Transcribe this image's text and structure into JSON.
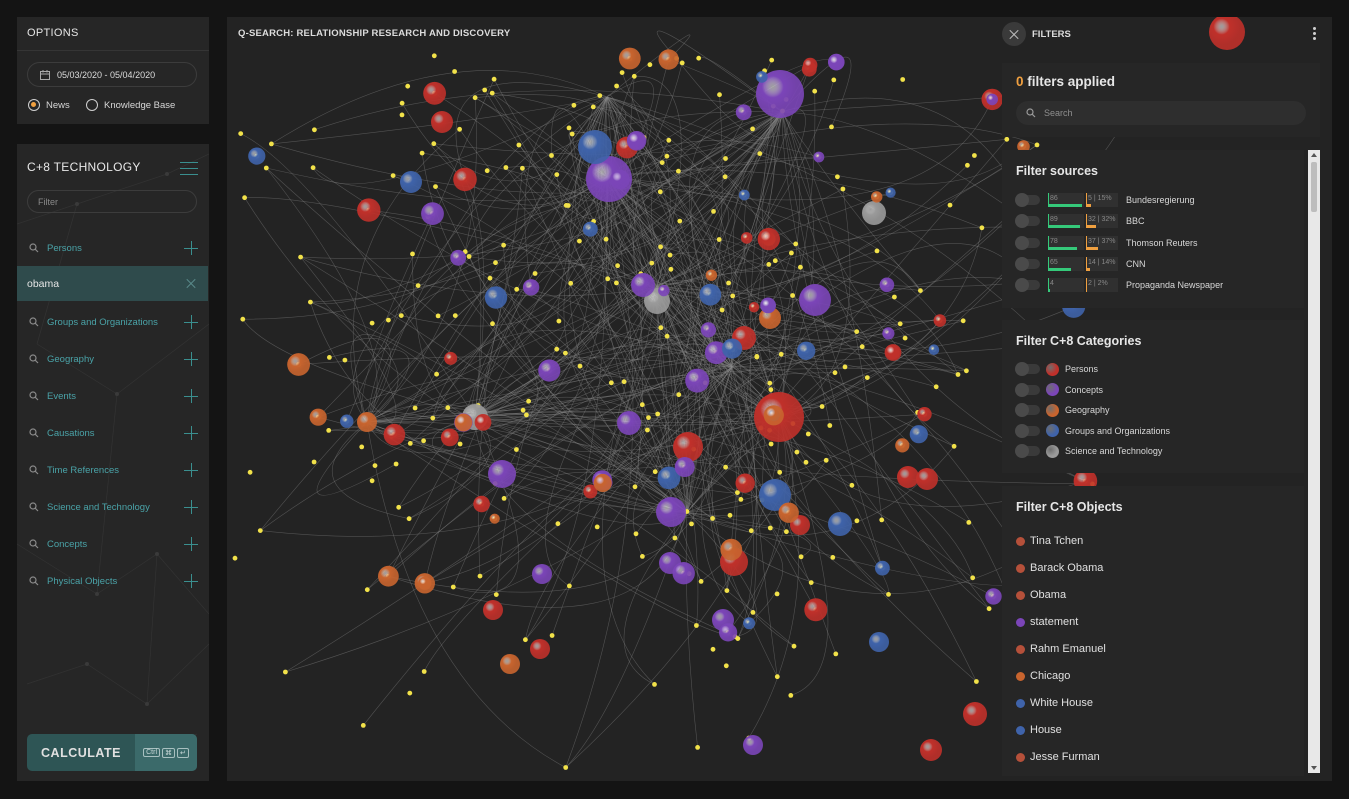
{
  "options": {
    "title": "OPTIONS",
    "date_range": "05/03/2020 - 05/04/2020",
    "radios": [
      {
        "label": "News",
        "selected": true
      },
      {
        "label": "Knowledge Base",
        "selected": false
      }
    ]
  },
  "sidebar": {
    "title": "C+8 TECHNOLOGY",
    "filter_placeholder": "Filter",
    "categories": [
      {
        "label": "Persons"
      },
      {
        "label": "Groups and Organizations"
      },
      {
        "label": "Geography"
      },
      {
        "label": "Events"
      },
      {
        "label": "Causations"
      },
      {
        "label": "Time References"
      },
      {
        "label": "Science and Technology"
      },
      {
        "label": "Concepts"
      },
      {
        "label": "Physical Objects"
      }
    ],
    "selected_entity": "obama",
    "calculate_label": "CALCULATE",
    "shortcut": [
      "Ctrl",
      "⌘",
      "↵"
    ]
  },
  "graph": {
    "title": "Q-SEARCH: RELATIONSHIP RESEARCH AND DISCOVERY",
    "filters_label": "FILTERS"
  },
  "filters": {
    "applied_count": "0",
    "applied_label": "filters applied",
    "search_placeholder": "Search",
    "sources_title": "Filter sources",
    "sources": [
      {
        "name": "Bundesregierung",
        "a": "86",
        "b": "5 | 15%",
        "green": 0.95,
        "orange": 0.15
      },
      {
        "name": "BBC",
        "a": "89",
        "b": "32 | 32%",
        "green": 0.9,
        "orange": 0.32
      },
      {
        "name": "Thomson Reuters",
        "a": "78",
        "b": "37 | 37%",
        "green": 0.8,
        "orange": 0.37
      },
      {
        "name": "CNN",
        "a": "65",
        "b": "14 | 14%",
        "green": 0.65,
        "orange": 0.14
      },
      {
        "name": "Propaganda Newspaper",
        "a": "4",
        "b": "2 | 2%",
        "green": 0.05,
        "orange": 0.02
      }
    ],
    "categories_title": "Filter C+8 Categories",
    "categories": [
      {
        "name": "Persons",
        "color": "#c0302a"
      },
      {
        "name": "Concepts",
        "color": "#7b45b8"
      },
      {
        "name": "Geography",
        "color": "#c8642e"
      },
      {
        "name": "Groups and Organizations",
        "color": "#3f63aa"
      },
      {
        "name": "Science and Technology",
        "color": "#9a9a9a"
      }
    ],
    "objects_title": "Filter C+8 Objects",
    "objects": [
      {
        "name": "Tina Tchen",
        "color": "#b5503a"
      },
      {
        "name": "Barack Obama",
        "color": "#b5503a"
      },
      {
        "name": "Obama",
        "color": "#b5503a"
      },
      {
        "name": "statement",
        "color": "#7b45b8"
      },
      {
        "name": "Rahm Emanuel",
        "color": "#b5503a"
      },
      {
        "name": "Chicago",
        "color": "#c8642e"
      },
      {
        "name": "White House",
        "color": "#3f63aa"
      },
      {
        "name": "House",
        "color": "#3f63aa"
      },
      {
        "name": "Jesse Furman",
        "color": "#b5503a"
      }
    ]
  }
}
